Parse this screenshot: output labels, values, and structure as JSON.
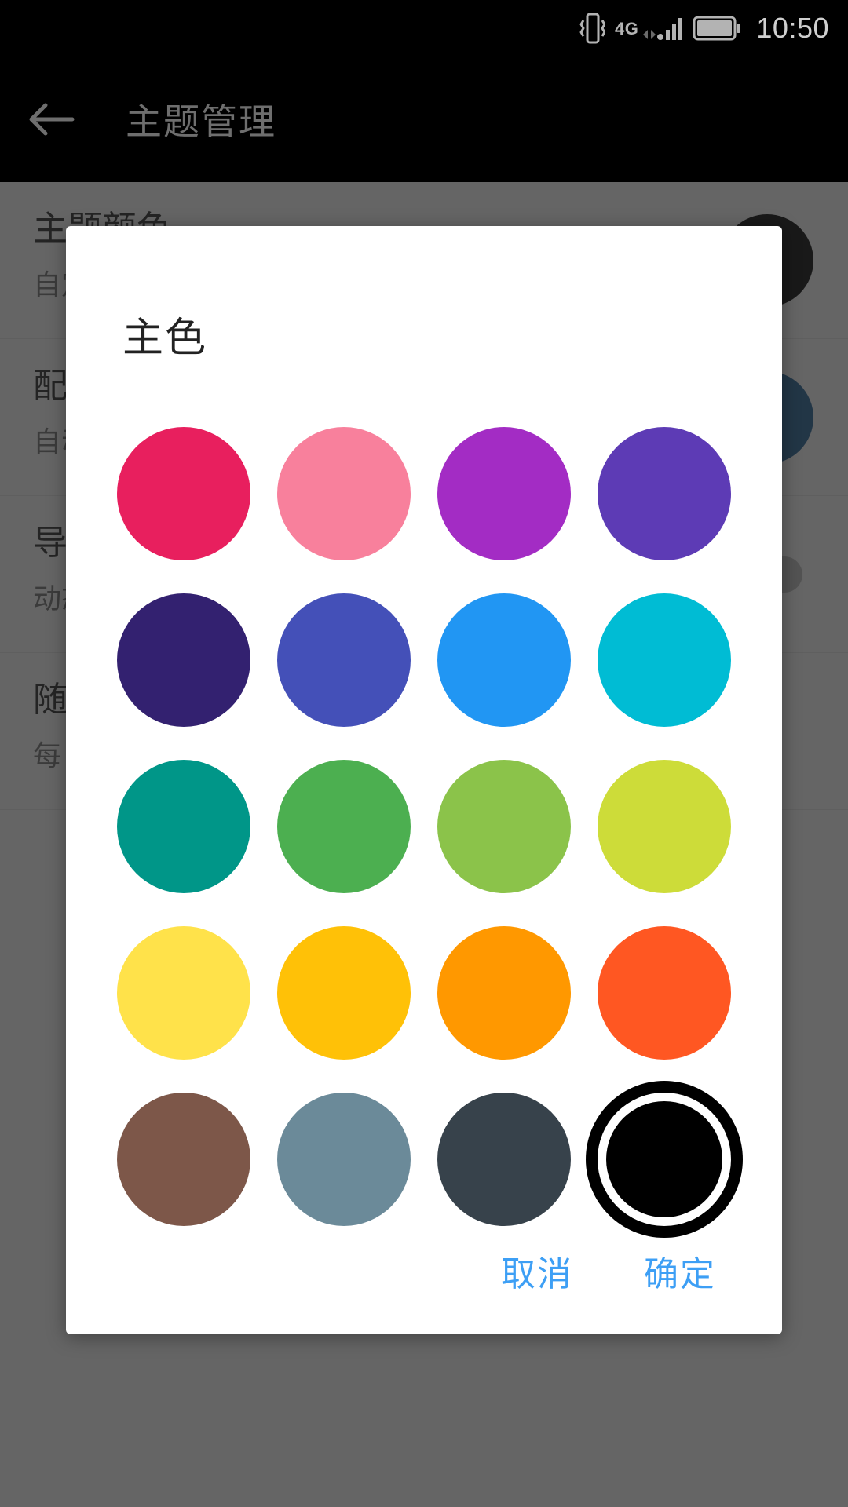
{
  "status_bar": {
    "vibrate_icon": "vibrate-icon",
    "network_type": "4G",
    "signal_icon": "signal-bars-icon",
    "battery_icon": "battery-full-icon",
    "time": "10:50"
  },
  "app_bar": {
    "back_icon": "back-arrow-icon",
    "title": "主题管理"
  },
  "background_list": {
    "rows": [
      {
        "title": "主题颜色",
        "subtitle": "自定义主题色",
        "accessory": "swatch",
        "swatch_color": "#000000"
      },
      {
        "title": "配色方案",
        "subtitle": "自动配色",
        "accessory": "swatch",
        "swatch_color": "#1a4c78"
      },
      {
        "title": "导航栏着色",
        "subtitle": "动态跟随主题色",
        "accessory": "toggle"
      },
      {
        "title": "随机主题",
        "subtitle": "每日更换主题色",
        "accessory": "none"
      }
    ]
  },
  "dialog": {
    "title": "主色",
    "selected_index": 19,
    "cancel_label": "取消",
    "confirm_label": "确定",
    "action_color": "#3d9ff5",
    "swatches": [
      {
        "name": "crimson",
        "color": "#e81f5e"
      },
      {
        "name": "pink",
        "color": "#f8809c"
      },
      {
        "name": "purple",
        "color": "#a32cc4"
      },
      {
        "name": "deep-purple",
        "color": "#5d3bb5"
      },
      {
        "name": "indigo-dark",
        "color": "#332170"
      },
      {
        "name": "indigo",
        "color": "#4450b8"
      },
      {
        "name": "blue",
        "color": "#2196f3"
      },
      {
        "name": "cyan",
        "color": "#00bcd4"
      },
      {
        "name": "teal",
        "color": "#009688"
      },
      {
        "name": "green",
        "color": "#4caf50"
      },
      {
        "name": "light-green",
        "color": "#8bc34a"
      },
      {
        "name": "lime",
        "color": "#cddc39"
      },
      {
        "name": "yellow",
        "color": "#ffe24a"
      },
      {
        "name": "amber",
        "color": "#ffc107"
      },
      {
        "name": "orange",
        "color": "#ff9800"
      },
      {
        "name": "deep-orange",
        "color": "#ff5722"
      },
      {
        "name": "brown",
        "color": "#7d5749"
      },
      {
        "name": "blue-grey",
        "color": "#6b8a99"
      },
      {
        "name": "dark-slate",
        "color": "#37424b"
      },
      {
        "name": "black",
        "color": "#000000"
      }
    ]
  }
}
